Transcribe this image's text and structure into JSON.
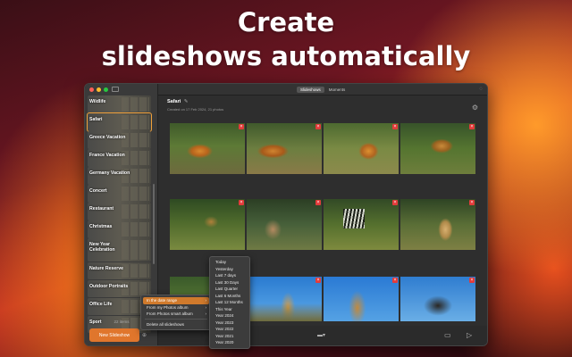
{
  "headline": {
    "line1": "Create",
    "line2": "slideshows automatically"
  },
  "sidebar": {
    "albums": [
      {
        "label": "Wildlife"
      },
      {
        "label": "Safari"
      },
      {
        "label": "Greece Vacation"
      },
      {
        "label": "France Vacation"
      },
      {
        "label": "Germany Vacation"
      },
      {
        "label": "Concert"
      },
      {
        "label": "Restaurant"
      },
      {
        "label": "Christmas"
      },
      {
        "label": "New Year Celebration"
      },
      {
        "label": "Nature Reserve"
      },
      {
        "label": "Outdoor Portraits"
      },
      {
        "label": "Office Life"
      },
      {
        "label": "Sport"
      }
    ],
    "items_count": "22 items",
    "new_button": "New Slideshow"
  },
  "toolbar": {
    "tabs": [
      "Slideshows",
      "Moments"
    ],
    "active_tab": "Slideshows"
  },
  "album_header": {
    "title": "Safari",
    "subtitle": "Created on 17 Feb 2024, 21 photos"
  },
  "photos": [
    {
      "subject": "tiger",
      "remove_glyph": "×"
    },
    {
      "subject": "tigers",
      "remove_glyph": "×"
    },
    {
      "subject": "tiger",
      "remove_glyph": "×"
    },
    {
      "subject": "tiger",
      "remove_glyph": "×"
    },
    {
      "subject": "lion",
      "remove_glyph": "×"
    },
    {
      "subject": "antelope",
      "remove_glyph": "×"
    },
    {
      "subject": "zebra",
      "remove_glyph": "×"
    },
    {
      "subject": "cheetah",
      "remove_glyph": "×"
    },
    {
      "subject": "giraffe",
      "remove_glyph": "×"
    },
    {
      "subject": "giraffe",
      "remove_glyph": "×"
    },
    {
      "subject": "giraffe",
      "remove_glyph": "×"
    },
    {
      "subject": "buffalo",
      "remove_glyph": "×"
    }
  ],
  "add_menu": {
    "items": [
      {
        "label": "In the date range",
        "highlighted": true,
        "has_submenu": true
      },
      {
        "label": "From my Photos album",
        "has_submenu": true
      },
      {
        "label": "From Photos smart album",
        "has_submenu": true
      }
    ],
    "delete_label": "Delete all slideshows"
  },
  "date_range_menu": {
    "items": [
      "Today",
      "Yesterday",
      "Last 7 days",
      "Last 30 Days",
      "Last Quarter",
      "Last 6 Months",
      "Last 12 Months",
      "This Year",
      "Year 2024",
      "Year 2023",
      "Year 2022",
      "Year 2021",
      "Year 2020"
    ]
  },
  "icons": {
    "pencil": "✎",
    "gear": "⚙",
    "submenu_arrow": "›",
    "add": "⊕",
    "airplay": "▭",
    "play": "▷"
  },
  "colors": {
    "accent": "#e0762c",
    "remove_badge": "#e23b3b"
  }
}
